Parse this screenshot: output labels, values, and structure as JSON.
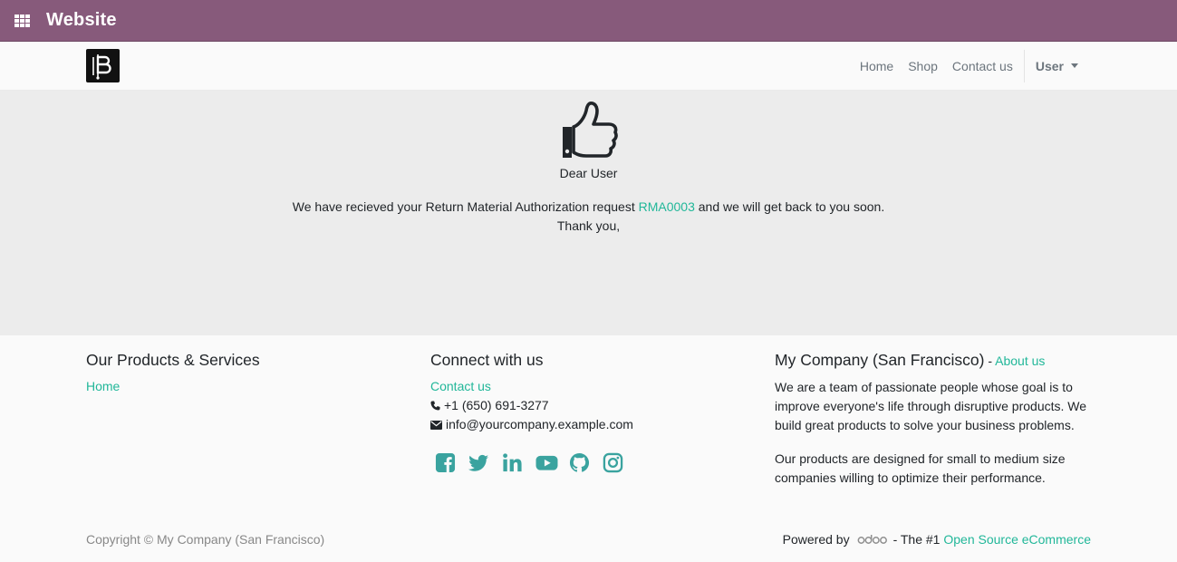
{
  "topbar": {
    "title": "Website"
  },
  "nav": {
    "links": [
      "Home",
      "Shop",
      "Contact us"
    ],
    "user": "User"
  },
  "main": {
    "greeting": "Dear User",
    "message_before": "We have recieved your Return Material Authorization request ",
    "rma_link": "RMA0003",
    "message_after": " and we will get back to you soon.",
    "thanks": "Thank you,"
  },
  "footer": {
    "col1": {
      "title": "Our Products & Services",
      "link": "Home"
    },
    "col2": {
      "title": "Connect with us",
      "contact_link": "Contact us",
      "phone": "+1 (650) 691-3277",
      "email": "info@yourcompany.example.com",
      "social_icons": [
        "facebook-icon",
        "twitter-icon",
        "linkedin-icon",
        "youtube-icon",
        "github-icon",
        "instagram-icon"
      ]
    },
    "col3": {
      "title": "My Company (San Francisco)",
      "title_sep": " - ",
      "about_link": "About us",
      "para1": "We are a team of passionate people whose goal is to improve everyone's life through disruptive products. We build great products to solve your business problems.",
      "para2": "Our products are designed for small to medium size companies willing to optimize their performance."
    },
    "copyright": "Copyright © My Company (San Francisco)",
    "powered_by": "Powered by",
    "powered_tail": "- The #1",
    "powered_link": "Open Source eCommerce"
  },
  "colors": {
    "brand": "#875a7b",
    "link": "#21b799",
    "social": "#3aa39f"
  }
}
